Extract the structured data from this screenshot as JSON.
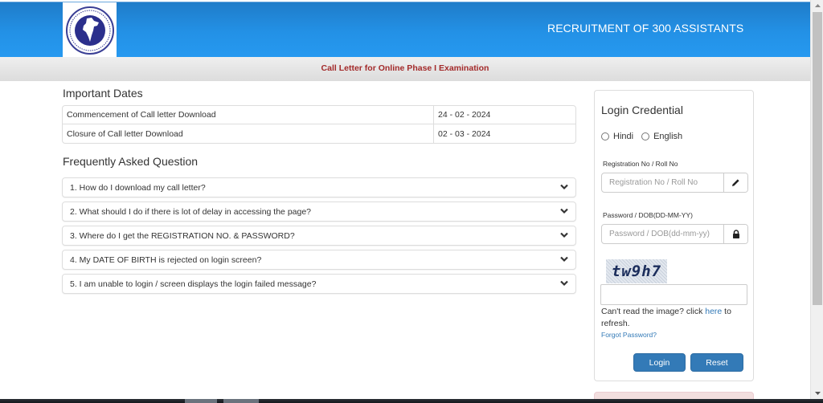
{
  "header": {
    "logo_alt": "The New India Assurance Co. Ltd. logo",
    "title": "RECRUITMENT OF 300 ASSISTANTS",
    "colors": {
      "gradient_top": "#1f7cc9",
      "gradient_bottom": "#2699f0"
    }
  },
  "subheader": {
    "title": "Call Letter for Online Phase I Examination",
    "color": "#a32a2a"
  },
  "important_dates": {
    "title": "Important Dates",
    "rows": [
      {
        "label": "Commencement of Call letter Download",
        "date": "24 - 02 - 2024"
      },
      {
        "label": "Closure of Call letter Download",
        "date": "02 - 03 - 2024"
      }
    ]
  },
  "faq": {
    "title": "Frequently Asked Question",
    "items": [
      {
        "question": "1. How do I download my call letter?",
        "icon": "chevron-down-icon"
      },
      {
        "question": "2. What should I do if there is lot of delay in accessing the page?",
        "icon": "chevron-down-icon"
      },
      {
        "question": "3. Where do I get the REGISTRATION NO. & PASSWORD?",
        "icon": "chevron-down-icon"
      },
      {
        "question": "4. My DATE OF BIRTH is rejected on login screen?",
        "icon": "chevron-down-icon"
      },
      {
        "question": "5. I am unable to login / screen displays the login failed message?",
        "icon": "chevron-down-icon"
      }
    ]
  },
  "login": {
    "title": "Login Credential",
    "languages": [
      {
        "label": "Hindi",
        "selected": false
      },
      {
        "label": "English",
        "selected": false
      }
    ],
    "registration": {
      "label": "Registration No / Roll No",
      "placeholder": "Registration No / Roll No",
      "value": "",
      "icon": "pencil-icon"
    },
    "password": {
      "label": "Password / DOB(DD-MM-YY)",
      "placeholder": "Password / DOB(dd-mm-yy)",
      "value": "",
      "icon": "lock-icon"
    },
    "captcha": {
      "text": "tw9h7",
      "input_value": ""
    },
    "refresh_prefix": "Can't read the image? click ",
    "refresh_link": "here",
    "refresh_suffix": " to refresh.",
    "forgot_password": "Forgot Password?",
    "login_button": "Login",
    "reset_button": "Reset",
    "accent_color": "#337ab7"
  }
}
